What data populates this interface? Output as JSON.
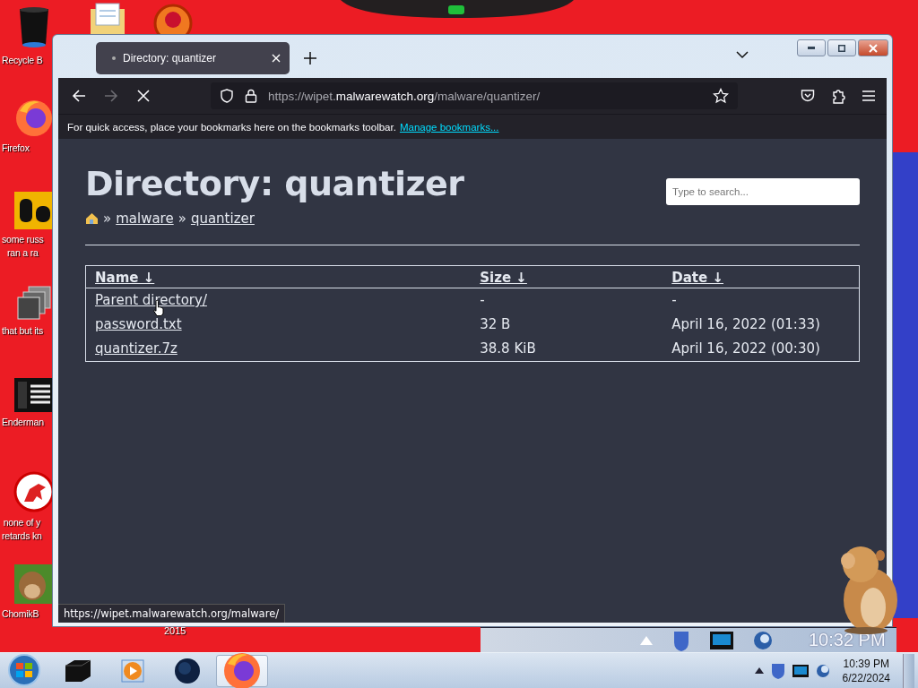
{
  "desktop_icons": [
    {
      "kind": "bin",
      "lines": [
        "Recycle B"
      ]
    },
    {
      "kind": "firefox",
      "lines": [
        "Firefox"
      ]
    },
    {
      "kind": "yellow-app",
      "lines": [
        "some russ",
        "ran a ra"
      ]
    },
    {
      "kind": "stack",
      "lines": [
        "that but its"
      ]
    },
    {
      "kind": "terminal",
      "lines": [
        "Enderman"
      ]
    },
    {
      "kind": "dino",
      "lines": [
        "none of y",
        "retards kn"
      ]
    },
    {
      "kind": "animal",
      "lines": [
        "ChomikB"
      ]
    }
  ],
  "desktop_caption": "2015",
  "browser": {
    "tabs": [
      {
        "title": "Directory: quantizer",
        "selected": true
      }
    ],
    "url": {
      "scheme": "https://wipet.",
      "domain": "malwarewatch.org",
      "path": "/malware/quantizer/"
    },
    "bookmarks_hint": "For quick access, place your bookmarks here on the bookmarks toolbar.",
    "bookmarks_link": "Manage bookmarks...",
    "page": {
      "title": "Directory: quantizer",
      "breadcrumb_separator": "»",
      "breadcrumb": [
        "malware",
        "quantizer"
      ],
      "search_placeholder": "Type to search...",
      "columns": [
        {
          "label": "Name",
          "sort": "↓"
        },
        {
          "label": "Size",
          "sort": "↓"
        },
        {
          "label": "Date",
          "sort": "↓"
        }
      ],
      "rows": [
        {
          "name": "Parent directory/",
          "size": "-",
          "date": "-"
        },
        {
          "name": "password.txt",
          "size": "32 B",
          "date": "April 16, 2022 (01:33)"
        },
        {
          "name": "quantizer.7z",
          "size": "38.8 KiB",
          "date": "April 16, 2022 (00:30)"
        }
      ]
    },
    "status_url": "https://wipet.malwarewatch.org/malware/"
  },
  "ghost_taskbar": {
    "time": "10:32 PM"
  },
  "taskbar": {
    "apps": [
      {
        "kind": "box",
        "selected": false
      },
      {
        "kind": "player",
        "selected": false
      },
      {
        "kind": "globe",
        "selected": false
      },
      {
        "kind": "firefox",
        "selected": true
      }
    ],
    "clock": {
      "time": "10:39 PM",
      "date": "6/22/2024"
    }
  }
}
